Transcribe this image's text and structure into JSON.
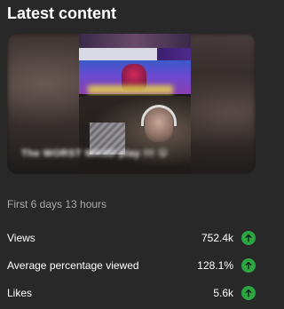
{
  "card": {
    "title": "Latest content",
    "period": "First 6 days 13 hours"
  },
  "thumbnail": {
    "caption": "The WORST WASD play !!! 😮"
  },
  "metrics": [
    {
      "label": "Views",
      "value": "752.4k",
      "trend": "up",
      "icon": "arrow-up-icon"
    },
    {
      "label": "Average percentage viewed",
      "value": "128.1%",
      "trend": "up",
      "icon": "arrow-up-icon"
    },
    {
      "label": "Likes",
      "value": "5.6k",
      "trend": "up",
      "icon": "arrow-up-icon"
    }
  ],
  "colors": {
    "background": "#282828",
    "text_primary": "#ffffff",
    "text_secondary": "#aaaaaa",
    "trend_up": "#2ba640"
  }
}
